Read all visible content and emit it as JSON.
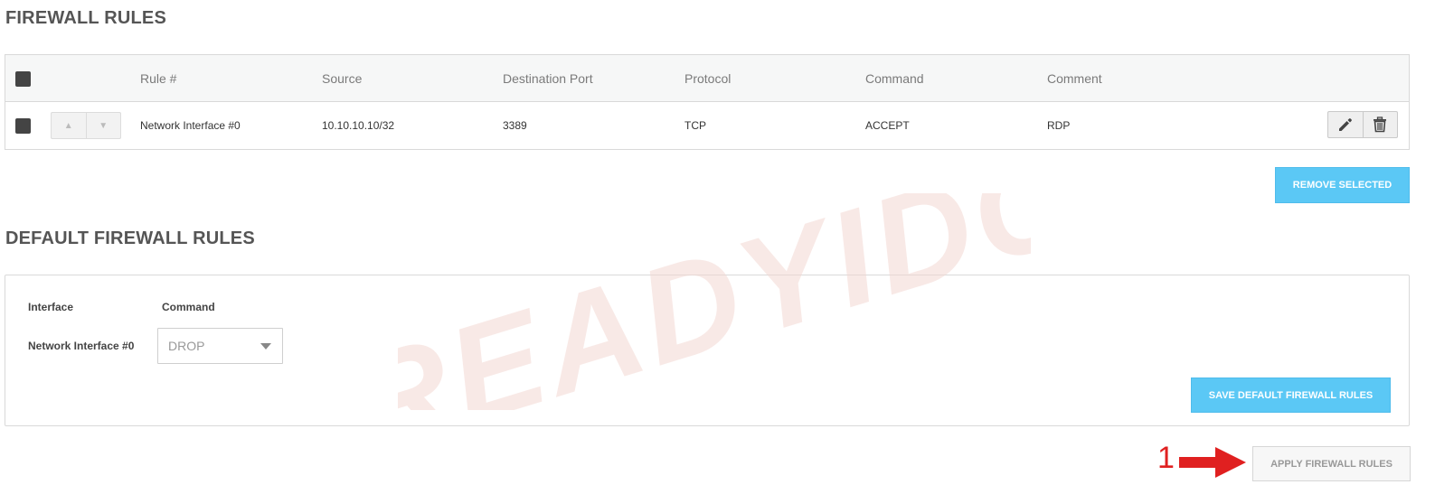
{
  "firewall_rules": {
    "title": "FIREWALL RULES",
    "columns": [
      "Rule #",
      "Source",
      "Destination Port",
      "Protocol",
      "Command",
      "Comment"
    ],
    "rows": [
      {
        "rule": "Network Interface #0",
        "source": "10.10.10.10/32",
        "destination_port": "3389",
        "protocol": "TCP",
        "command": "ACCEPT",
        "comment": "RDP"
      }
    ],
    "order_up_glyph": "▲",
    "order_down_glyph": "▼",
    "edit_icon": "pencil-icon",
    "delete_icon": "trash-icon",
    "remove_selected_label": "REMOVE SELECTED"
  },
  "default_rules": {
    "title": "DEFAULT FIREWALL RULES",
    "header_interface": "Interface",
    "header_command": "Command",
    "interface_name": "Network Interface #0",
    "command_value": "DROP",
    "save_label": "SAVE DEFAULT FIREWALL RULES"
  },
  "apply_label": "APPLY FIREWALL RULES",
  "annotation": {
    "number": "1",
    "color": "#e02020"
  },
  "watermark": {
    "text": "READYIDC"
  },
  "colors": {
    "accent": "#5bc8f5",
    "checkbox": "#444444",
    "title": "#555555"
  }
}
